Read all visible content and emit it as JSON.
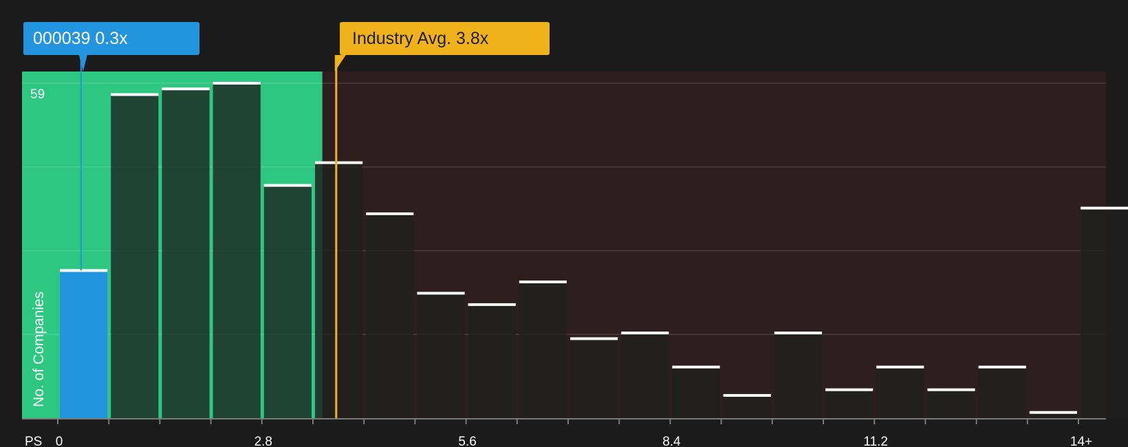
{
  "chart_data": {
    "type": "bar",
    "x_axis_label": "PS",
    "y_axis_label": "No. of Companies",
    "y_max_label": "59",
    "ylim": [
      0,
      59
    ],
    "bin_width": 0.7,
    "x_ticks": [
      "0",
      "2.8",
      "5.6",
      "8.4",
      "11.2",
      "14+"
    ],
    "values": [
      26,
      57,
      58,
      59,
      41,
      45,
      36,
      22,
      20,
      24,
      14,
      15,
      9,
      4,
      15,
      5,
      9,
      5,
      9,
      1,
      37
    ],
    "highlight_bin_index": 0,
    "company": {
      "label": "000039 0.3x",
      "ps": 0.3
    },
    "industry": {
      "label": "Industry Avg. 3.8x",
      "ps": 3.8
    },
    "colors": {
      "background": "#1b1b1b",
      "below_avg_region": "#2ec781",
      "above_avg_region": "#2f1e1f",
      "company": "#2394e0",
      "industry": "#efb21b",
      "bar_cap": "#ffffff"
    }
  }
}
